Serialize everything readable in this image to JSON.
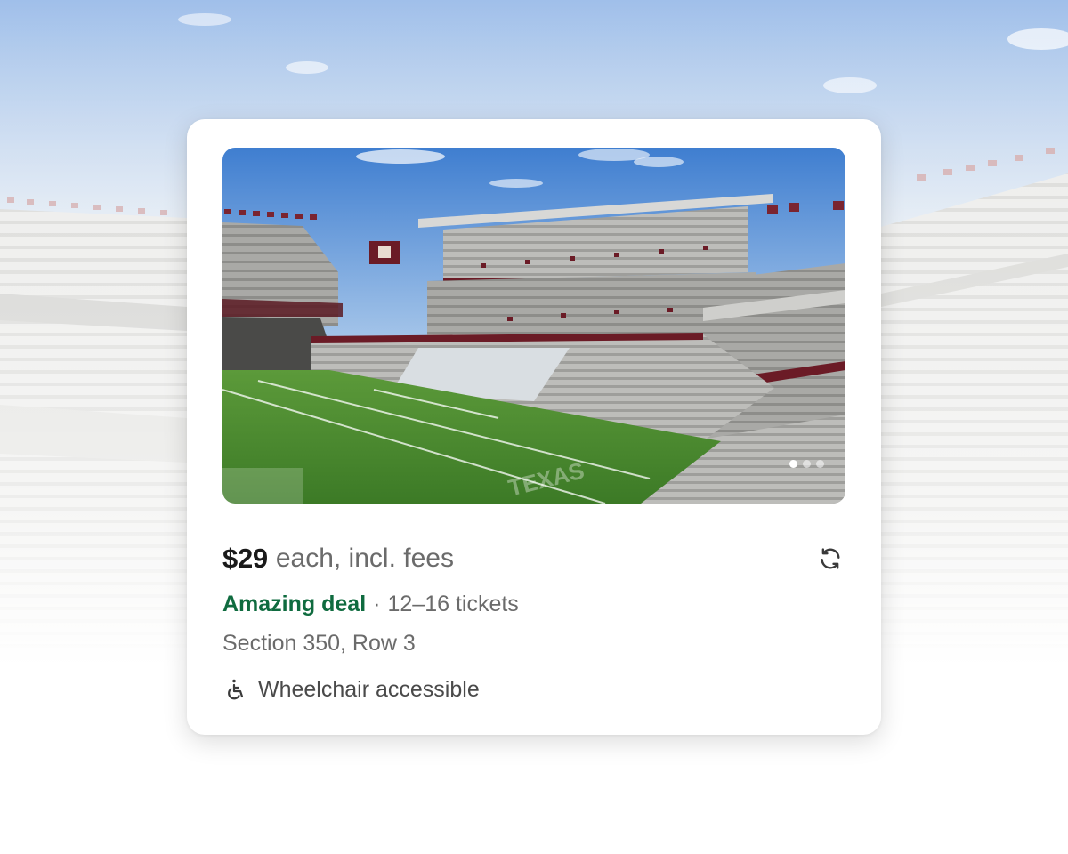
{
  "listing": {
    "price": "$29",
    "price_suffix": "each, incl. fees",
    "deal_label": "Amazing deal",
    "separator": "·",
    "ticket_range": "12–16 tickets",
    "section_row": "Section 350, Row 3",
    "accessibility": "Wheelchair accessible"
  },
  "photo_carousel": {
    "image": "stadium-view-from-seat",
    "dots": 3,
    "active_index": 0
  },
  "colors": {
    "deal_green": "#0f6b3f",
    "price_text": "#1a1a1a",
    "muted_text": "#6b6b6b",
    "field_green": "#3f8a2e",
    "sky_blue": "#7fa8dc",
    "maroon": "#6b1b26"
  },
  "icons": {
    "refresh": "refresh-icon",
    "wheelchair": "wheelchair-icon"
  }
}
